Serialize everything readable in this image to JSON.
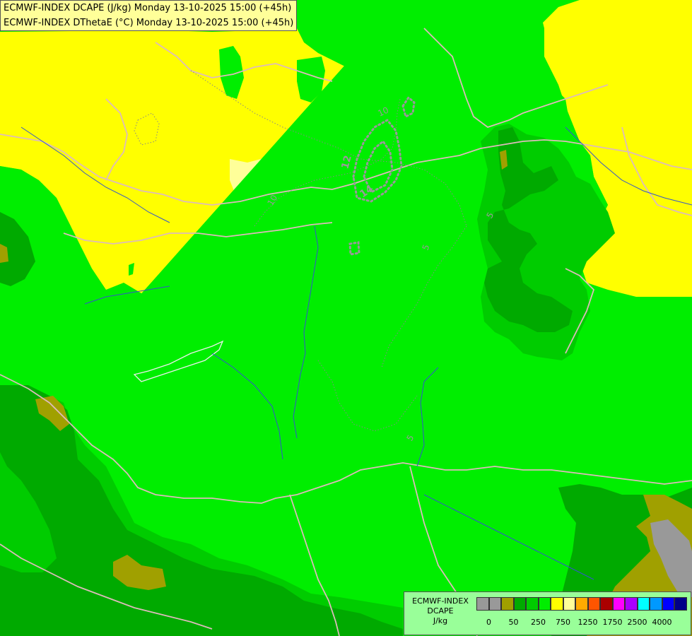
{
  "title": {
    "line1": "ECMWF-INDEX DCAPE (J/kg) Monday 13-10-2025 15:00 (+45h)",
    "line2": "ECMWF-INDEX DThetaE (°C) Monday 13-10-2025 15:00 (+45h)"
  },
  "legend": {
    "title_line1": "ECMWF-INDEX",
    "title_line2": "DCAPE",
    "title_line3": "J/kg",
    "colors": [
      "#999999",
      "#999999",
      "#a0a000",
      "#00aa00",
      "#00cc00",
      "#00ee00",
      "#ffff00",
      "#ffff99",
      "#ffaa00",
      "#ff5500",
      "#aa0000",
      "#ff00ff",
      "#aa00ff",
      "#00ffff",
      "#0099ff",
      "#0000ff",
      "#000088"
    ],
    "tick_labels": [
      "0",
      "50",
      "250",
      "750",
      "1250",
      "1750",
      "2500",
      "4000"
    ]
  },
  "contour_labels": [
    "10",
    "12",
    "14",
    "10",
    "5",
    "5",
    "5",
    "10",
    "10"
  ],
  "palette": {
    "bright_green": "#00ee00",
    "mid_green": "#00cc00",
    "dark_green": "#00aa00",
    "olive": "#a0a000",
    "yellow": "#ffff00",
    "light_yellow": "#ffff99",
    "gray": "#999999",
    "border": "#ddbbbb",
    "river": "#3355cc"
  }
}
